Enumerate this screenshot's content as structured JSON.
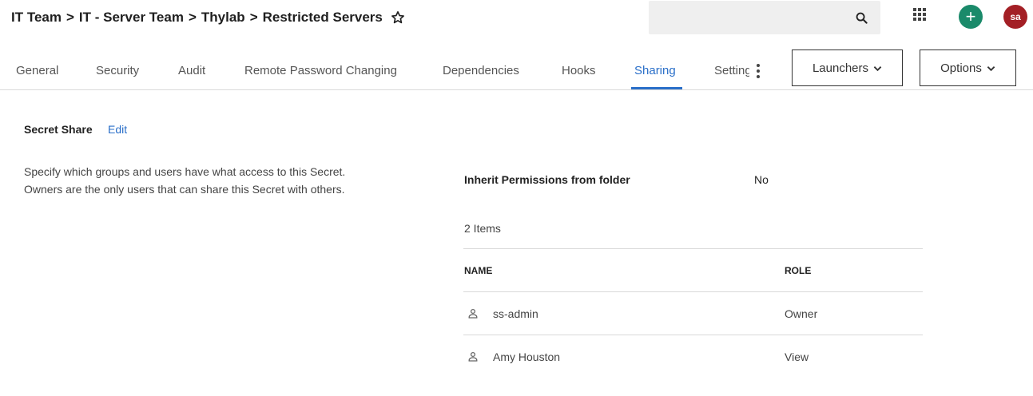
{
  "breadcrumb": {
    "items": [
      "IT Team",
      "IT - Server Team",
      "Thylab",
      "Restricted Servers"
    ],
    "separator": ">"
  },
  "header": {
    "search_placeholder": "",
    "add_label": "+",
    "avatar_initials": "sa"
  },
  "tabs": [
    {
      "label": "General"
    },
    {
      "label": "Security"
    },
    {
      "label": "Audit"
    },
    {
      "label": "Remote Password Changing"
    },
    {
      "label": "Dependencies"
    },
    {
      "label": "Hooks"
    },
    {
      "label": "Sharing",
      "active": true
    },
    {
      "label": "Settings"
    }
  ],
  "buttons": {
    "launchers": "Launchers",
    "options": "Options"
  },
  "secret_share": {
    "title": "Secret Share",
    "edit": "Edit",
    "description": "Specify which groups and users have what access to this Secret. Owners are the only users that can share this Secret with others."
  },
  "permissions": {
    "inherit_label": "Inherit Permissions from folder",
    "inherit_value": "No",
    "items_count": "2 Items",
    "columns": {
      "name": "NAME",
      "role": "ROLE"
    },
    "rows": [
      {
        "name": "ss-admin",
        "role": "Owner"
      },
      {
        "name": "Amy Houston",
        "role": "View"
      }
    ]
  },
  "colors": {
    "accent": "#2a6fc9",
    "add_button": "#1a8a6a",
    "avatar": "#a31f25"
  }
}
